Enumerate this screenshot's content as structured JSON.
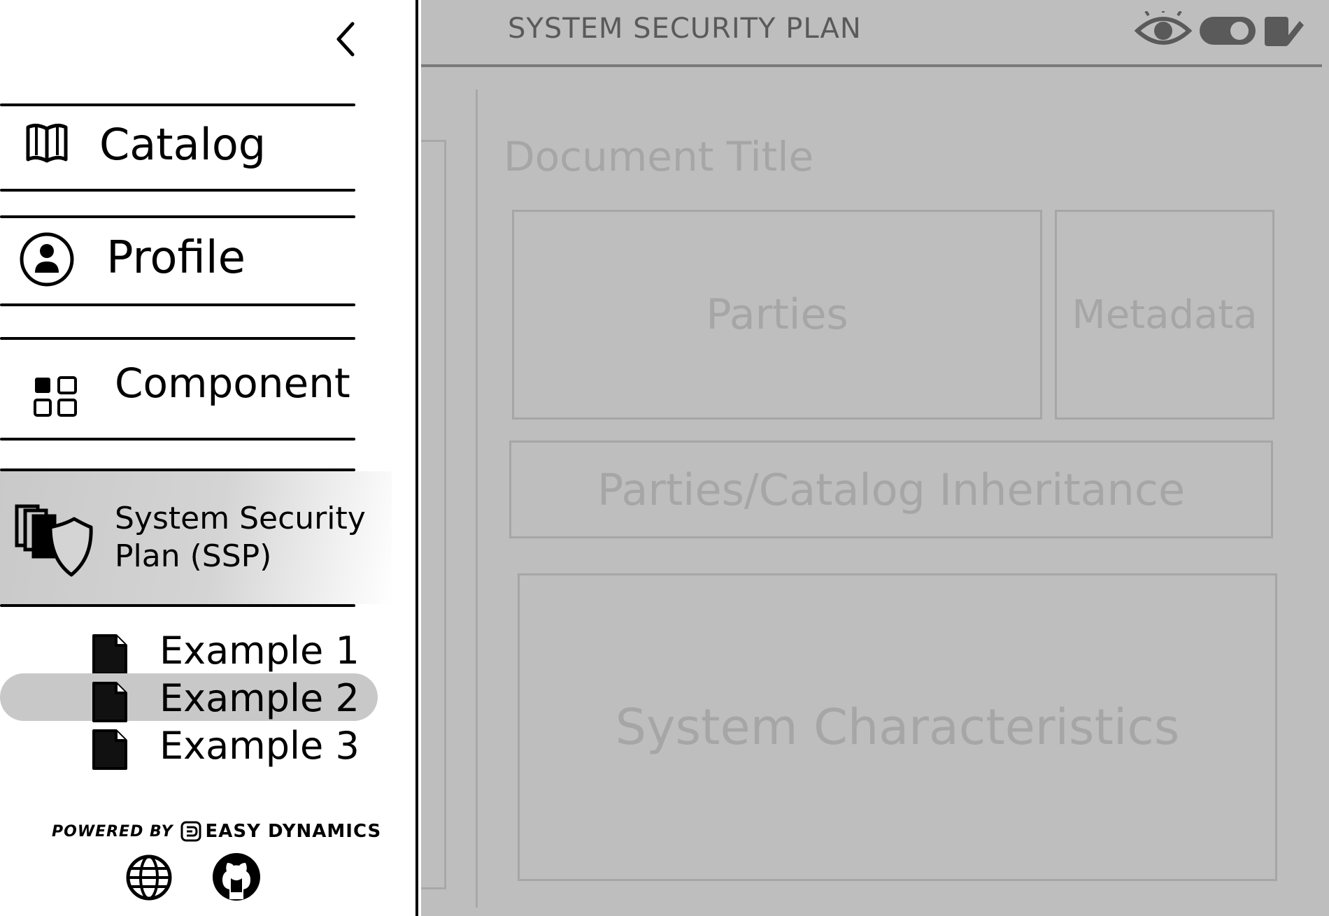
{
  "sidebar": {
    "items": [
      {
        "label": "Catalog",
        "icon": "book-icon"
      },
      {
        "label": "Profile",
        "icon": "profile-icon"
      },
      {
        "label": "Component",
        "icon": "component-grid-icon"
      },
      {
        "label_line1": "System Security",
        "label_line2": "Plan (SSP)",
        "icon": "ssp-shield-icon",
        "active": true
      }
    ],
    "ssp_documents": [
      {
        "label": "Example 1",
        "selected": false
      },
      {
        "label": "Example 2",
        "selected": true
      },
      {
        "label": "Example 3",
        "selected": false
      }
    ],
    "footer": {
      "powered_by": "POWERED BY",
      "brand": "EASY DYNAMICS"
    }
  },
  "main": {
    "header_title": "SYSTEM SECURITY PLAN",
    "document_title": "Document Title",
    "sections": {
      "parties": "Parties",
      "metadata": "Metadata",
      "inheritance": "Parties/Catalog Inheritance",
      "system_characteristics": "System Characteristics"
    }
  },
  "colors": {
    "overlay_gray": "#bebebe",
    "faded_text": "#a6a6a6",
    "selected_bg": "#c8c8c8"
  }
}
